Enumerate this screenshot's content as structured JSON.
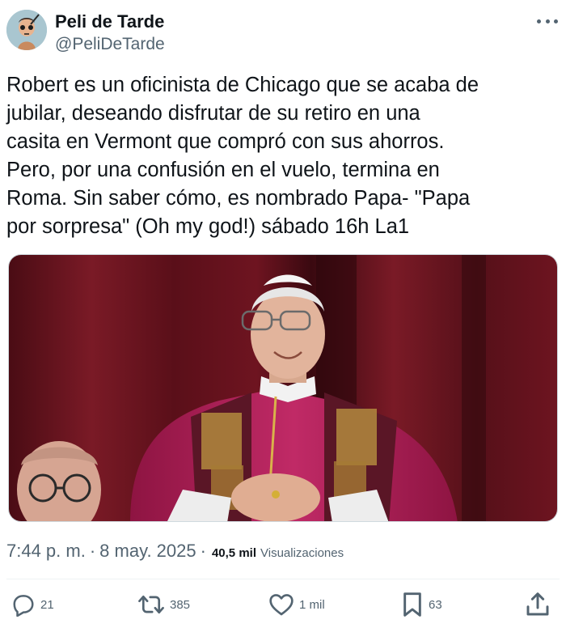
{
  "author": {
    "display_name": "Peli de Tarde",
    "handle": "@PeliDeTarde",
    "avatar_icon": "avatar-image"
  },
  "more_icon": "more-options-icon",
  "tweet": {
    "text": "Robert es un oficinista de Chicago que se acaba de\njubilar, deseando disfrutar de su retiro en una\ncasita en Vermont que compró con sus ahorros.\nPero, por una confusión en el vuelo, termina en\nRoma. Sin saber cómo, es nombrado Papa- \"Papa\npor sorpresa\" (Oh my god!) sábado 16h La1"
  },
  "media": {
    "description_icon": "pope-photo-image"
  },
  "meta": {
    "time": "7:44 p. m.",
    "separator": "·",
    "date": "8 may. 2025",
    "views_count": "40,5 mil",
    "views_label": "Visualizaciones"
  },
  "actions": {
    "reply": {
      "icon": "reply-icon",
      "count": "21"
    },
    "retweet": {
      "icon": "retweet-icon",
      "count": "385"
    },
    "like": {
      "icon": "heart-icon",
      "count": "1 mil"
    },
    "bookmark": {
      "icon": "bookmark-icon",
      "count": "63"
    },
    "share": {
      "icon": "share-icon"
    }
  },
  "colors": {
    "text_primary": "#0f1419",
    "text_secondary": "#536471",
    "divider": "#eff3f4",
    "curtain": "#6e1420",
    "vestment": "#b8245f"
  }
}
